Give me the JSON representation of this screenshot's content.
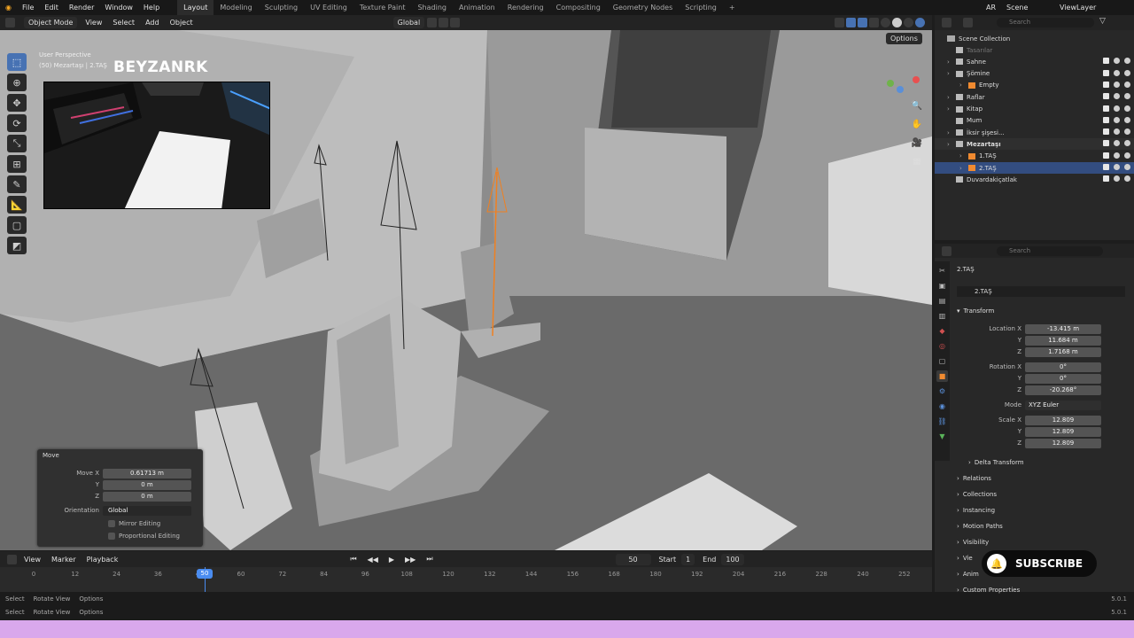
{
  "topbar": {
    "menus": [
      "File",
      "Edit",
      "Render",
      "Window",
      "Help"
    ],
    "workspaces": [
      "Layout",
      "Modeling",
      "Sculpting",
      "UV Editing",
      "Texture Paint",
      "Shading",
      "Animation",
      "Rendering",
      "Compositing",
      "Geometry Nodes",
      "Scripting"
    ],
    "active_workspace": "Layout",
    "add_tab": "+",
    "scene": "Scene",
    "view_layer": "ViewLayer",
    "lang": "AR"
  },
  "viewport_header": {
    "mode": "Object Mode",
    "menus": [
      "View",
      "Select",
      "Add",
      "Object"
    ],
    "orientation": "Global",
    "options": "Options"
  },
  "viewport": {
    "perspective": "User Perspective",
    "context": "(50) Mezartaşı | 2.TAŞ",
    "watermark": "BEYZANRK"
  },
  "move_panel": {
    "title": "Move",
    "move_x_label": "Move X",
    "move_x": "0.61713 m",
    "y_label": "Y",
    "y": "0 m",
    "z_label": "Z",
    "z": "0 m",
    "orientation_label": "Orientation",
    "orientation": "Global",
    "mirror": "Mirror Editing",
    "proportional": "Proportional Editing"
  },
  "timeline": {
    "menus": [
      "View",
      "Marker",
      "Playback"
    ],
    "current_frame": "50",
    "start_label": "Start",
    "start": "1",
    "end_label": "End",
    "end": "100",
    "ticks": [
      "0",
      "12",
      "24",
      "36",
      "48",
      "60",
      "72",
      "84",
      "96",
      "108",
      "120",
      "132",
      "144",
      "156",
      "168",
      "180",
      "192",
      "204",
      "216",
      "228",
      "240",
      "252"
    ],
    "marker": "50"
  },
  "statusbar": {
    "items": [
      "Select",
      "Rotate View",
      "Options"
    ],
    "version": "5.0.1"
  },
  "outliner": {
    "search_placeholder": "Search",
    "collection": "Scene Collection",
    "rows": [
      {
        "name": "Tasarılar",
        "dim": true
      },
      {
        "name": "Sahne",
        "exp": true
      },
      {
        "name": "Şömine",
        "exp": true
      },
      {
        "name": "Empty",
        "exp": true,
        "indent": 1
      },
      {
        "name": "Raflar",
        "exp": true
      },
      {
        "name": "Kitap",
        "exp": true
      },
      {
        "name": "Mum"
      },
      {
        "name": "İksir şişesi...",
        "exp": true
      },
      {
        "name": "Mezartaşı",
        "exp": true,
        "bold": true
      },
      {
        "name": "1.TAŞ",
        "indent": 1,
        "exp": true
      },
      {
        "name": "2.TAŞ",
        "indent": 1,
        "exp": true,
        "selected": true
      },
      {
        "name": "Duvardakiçatlak"
      }
    ]
  },
  "properties": {
    "search_placeholder": "Search",
    "object": "2.TAŞ",
    "object_name": "2.TAŞ",
    "transform": "Transform",
    "location_x_label": "Location X",
    "location_x": "-13.415 m",
    "location_y": "11.684 m",
    "location_z": "1.7168 m",
    "rotation_x_label": "Rotation X",
    "rotation_x": "0°",
    "rotation_y": "0°",
    "rotation_z": "-20.268°",
    "mode_label": "Mode",
    "mode": "XYZ Euler",
    "scale_x_label": "Scale X",
    "scale_x": "12.809",
    "scale_y": "12.809",
    "scale_z": "12.809",
    "y_label": "Y",
    "z_label": "Z",
    "sections": [
      "Delta Transform",
      "Relations",
      "Collections",
      "Instancing",
      "Motion Paths",
      "Visibility",
      "View",
      "Animation",
      "Custom Properties"
    ],
    "visible_view": "Vie",
    "visible_anim": "Anim"
  },
  "subscribe": "SUBSCRIBE"
}
